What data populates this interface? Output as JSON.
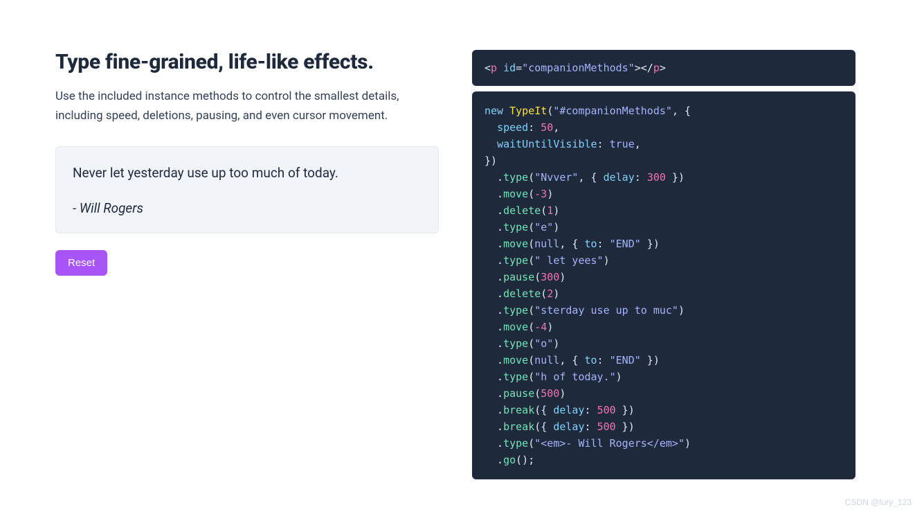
{
  "left": {
    "heading": "Type fine-grained, life-like effects.",
    "subheading": "Use the included instance methods to control the smallest details, including speed, deletions, pausing, and even cursor movement.",
    "example_line1": "Never let yesterday use up too much of today.",
    "example_line2": "- Will Rogers",
    "reset_label": "Reset"
  },
  "snippet_html": {
    "tokens": [
      {
        "t": "<",
        "c": "punct"
      },
      {
        "t": "p",
        "c": "tag"
      },
      {
        "t": " ",
        "c": "punct"
      },
      {
        "t": "id",
        "c": "attr"
      },
      {
        "t": "=",
        "c": "punct"
      },
      {
        "t": "\"companionMethods\"",
        "c": "str"
      },
      {
        "t": ">",
        "c": "punct"
      },
      {
        "t": "</",
        "c": "punct"
      },
      {
        "t": "p",
        "c": "tag"
      },
      {
        "t": ">",
        "c": "punct"
      }
    ]
  },
  "snippet_js": {
    "lines": [
      [
        {
          "t": "new",
          "c": "kw"
        },
        {
          "t": " ",
          "c": "punct"
        },
        {
          "t": "TypeIt",
          "c": "class"
        },
        {
          "t": "(",
          "c": "punct"
        },
        {
          "t": "\"#companionMethods\"",
          "c": "str"
        },
        {
          "t": ", {",
          "c": "punct"
        }
      ],
      [
        {
          "t": "  ",
          "c": "punct"
        },
        {
          "t": "speed",
          "c": "prop"
        },
        {
          "t": ": ",
          "c": "punct"
        },
        {
          "t": "50",
          "c": "num"
        },
        {
          "t": ",",
          "c": "punct"
        }
      ],
      [
        {
          "t": "  ",
          "c": "punct"
        },
        {
          "t": "waitUntilVisible",
          "c": "prop"
        },
        {
          "t": ": ",
          "c": "punct"
        },
        {
          "t": "true",
          "c": "bool"
        },
        {
          "t": ",",
          "c": "punct"
        }
      ],
      [
        {
          "t": "})",
          "c": "punct"
        }
      ],
      [
        {
          "t": "  .",
          "c": "punct"
        },
        {
          "t": "type",
          "c": "fn"
        },
        {
          "t": "(",
          "c": "punct"
        },
        {
          "t": "\"Nvver\"",
          "c": "str"
        },
        {
          "t": ", { ",
          "c": "punct"
        },
        {
          "t": "delay",
          "c": "prop"
        },
        {
          "t": ": ",
          "c": "punct"
        },
        {
          "t": "300",
          "c": "num"
        },
        {
          "t": " })",
          "c": "punct"
        }
      ],
      [
        {
          "t": "  .",
          "c": "punct"
        },
        {
          "t": "move",
          "c": "fn"
        },
        {
          "t": "(",
          "c": "punct"
        },
        {
          "t": "-3",
          "c": "num"
        },
        {
          "t": ")",
          "c": "punct"
        }
      ],
      [
        {
          "t": "  .",
          "c": "punct"
        },
        {
          "t": "delete",
          "c": "fn"
        },
        {
          "t": "(",
          "c": "punct"
        },
        {
          "t": "1",
          "c": "num"
        },
        {
          "t": ")",
          "c": "punct"
        }
      ],
      [
        {
          "t": "  .",
          "c": "punct"
        },
        {
          "t": "type",
          "c": "fn"
        },
        {
          "t": "(",
          "c": "punct"
        },
        {
          "t": "\"e\"",
          "c": "str"
        },
        {
          "t": ")",
          "c": "punct"
        }
      ],
      [
        {
          "t": "  .",
          "c": "punct"
        },
        {
          "t": "move",
          "c": "fn"
        },
        {
          "t": "(",
          "c": "punct"
        },
        {
          "t": "null",
          "c": "null"
        },
        {
          "t": ", { ",
          "c": "punct"
        },
        {
          "t": "to",
          "c": "prop"
        },
        {
          "t": ": ",
          "c": "punct"
        },
        {
          "t": "\"END\"",
          "c": "str"
        },
        {
          "t": " })",
          "c": "punct"
        }
      ],
      [
        {
          "t": "  .",
          "c": "punct"
        },
        {
          "t": "type",
          "c": "fn"
        },
        {
          "t": "(",
          "c": "punct"
        },
        {
          "t": "\" let yees\"",
          "c": "str"
        },
        {
          "t": ")",
          "c": "punct"
        }
      ],
      [
        {
          "t": "  .",
          "c": "punct"
        },
        {
          "t": "pause",
          "c": "fn"
        },
        {
          "t": "(",
          "c": "punct"
        },
        {
          "t": "300",
          "c": "num"
        },
        {
          "t": ")",
          "c": "punct"
        }
      ],
      [
        {
          "t": "  .",
          "c": "punct"
        },
        {
          "t": "delete",
          "c": "fn"
        },
        {
          "t": "(",
          "c": "punct"
        },
        {
          "t": "2",
          "c": "num"
        },
        {
          "t": ")",
          "c": "punct"
        }
      ],
      [
        {
          "t": "  .",
          "c": "punct"
        },
        {
          "t": "type",
          "c": "fn"
        },
        {
          "t": "(",
          "c": "punct"
        },
        {
          "t": "\"sterday use up to muc\"",
          "c": "str"
        },
        {
          "t": ")",
          "c": "punct"
        }
      ],
      [
        {
          "t": "  .",
          "c": "punct"
        },
        {
          "t": "move",
          "c": "fn"
        },
        {
          "t": "(",
          "c": "punct"
        },
        {
          "t": "-4",
          "c": "num"
        },
        {
          "t": ")",
          "c": "punct"
        }
      ],
      [
        {
          "t": "  .",
          "c": "punct"
        },
        {
          "t": "type",
          "c": "fn"
        },
        {
          "t": "(",
          "c": "punct"
        },
        {
          "t": "\"o\"",
          "c": "str"
        },
        {
          "t": ")",
          "c": "punct"
        }
      ],
      [
        {
          "t": "  .",
          "c": "punct"
        },
        {
          "t": "move",
          "c": "fn"
        },
        {
          "t": "(",
          "c": "punct"
        },
        {
          "t": "null",
          "c": "null"
        },
        {
          "t": ", { ",
          "c": "punct"
        },
        {
          "t": "to",
          "c": "prop"
        },
        {
          "t": ": ",
          "c": "punct"
        },
        {
          "t": "\"END\"",
          "c": "str"
        },
        {
          "t": " })",
          "c": "punct"
        }
      ],
      [
        {
          "t": "  .",
          "c": "punct"
        },
        {
          "t": "type",
          "c": "fn"
        },
        {
          "t": "(",
          "c": "punct"
        },
        {
          "t": "\"h of today.\"",
          "c": "str"
        },
        {
          "t": ")",
          "c": "punct"
        }
      ],
      [
        {
          "t": "  .",
          "c": "punct"
        },
        {
          "t": "pause",
          "c": "fn"
        },
        {
          "t": "(",
          "c": "punct"
        },
        {
          "t": "500",
          "c": "num"
        },
        {
          "t": ")",
          "c": "punct"
        }
      ],
      [
        {
          "t": "  .",
          "c": "punct"
        },
        {
          "t": "break",
          "c": "fn"
        },
        {
          "t": "({ ",
          "c": "punct"
        },
        {
          "t": "delay",
          "c": "prop"
        },
        {
          "t": ": ",
          "c": "punct"
        },
        {
          "t": "500",
          "c": "num"
        },
        {
          "t": " })",
          "c": "punct"
        }
      ],
      [
        {
          "t": "  .",
          "c": "punct"
        },
        {
          "t": "break",
          "c": "fn"
        },
        {
          "t": "({ ",
          "c": "punct"
        },
        {
          "t": "delay",
          "c": "prop"
        },
        {
          "t": ": ",
          "c": "punct"
        },
        {
          "t": "500",
          "c": "num"
        },
        {
          "t": " })",
          "c": "punct"
        }
      ],
      [
        {
          "t": "  .",
          "c": "punct"
        },
        {
          "t": "type",
          "c": "fn"
        },
        {
          "t": "(",
          "c": "punct"
        },
        {
          "t": "\"<em>- Will Rogers</em>\"",
          "c": "str"
        },
        {
          "t": ")",
          "c": "punct"
        }
      ],
      [
        {
          "t": "  .",
          "c": "punct"
        },
        {
          "t": "go",
          "c": "fn"
        },
        {
          "t": "();",
          "c": "punct"
        }
      ]
    ]
  },
  "watermark": "CSDN @fury_123"
}
